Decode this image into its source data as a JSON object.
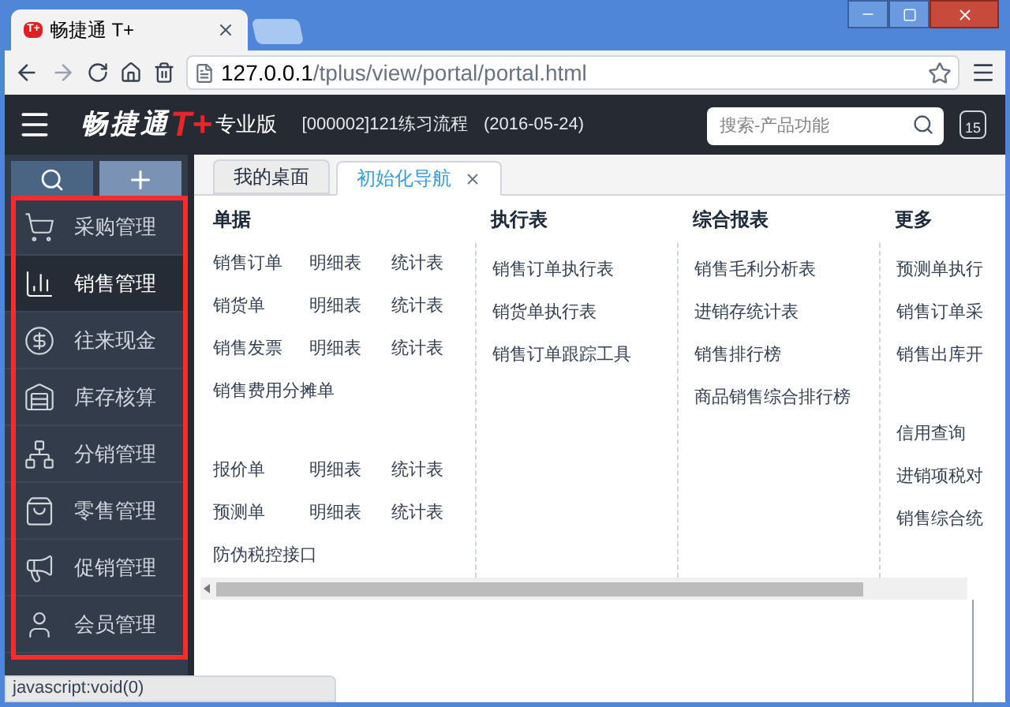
{
  "browser": {
    "tab": {
      "favicon_text": "T+",
      "title": "畅捷通 T+"
    },
    "url_host": "127.0.0.1",
    "url_path": "/tplus/view/portal/portal.html",
    "status_text": "javascript:void(0)"
  },
  "header": {
    "logo_text": "畅捷通",
    "logo_mark": "T+",
    "edition": "专业版",
    "company": "[000002]121练习流程",
    "date": "(2016-05-24)",
    "search": {
      "placeholder": "搜索-产品功能"
    },
    "calendar_day": "15"
  },
  "sidebar": {
    "items": [
      {
        "label": "采购管理",
        "selected": false
      },
      {
        "label": "销售管理",
        "selected": true
      },
      {
        "label": "往来现金",
        "selected": false
      },
      {
        "label": "库存核算",
        "selected": false
      },
      {
        "label": "分销管理",
        "selected": false
      },
      {
        "label": "零售管理",
        "selected": false
      },
      {
        "label": "促销管理",
        "selected": false
      },
      {
        "label": "会员管理",
        "selected": false
      }
    ]
  },
  "tabs": [
    {
      "label": "我的桌面",
      "selected": false,
      "closable": false
    },
    {
      "label": "初始化导航",
      "selected": true,
      "closable": true
    }
  ],
  "columns": [
    {
      "title": "单据",
      "groups": [
        [
          [
            "销售订单",
            "明细表",
            "统计表"
          ],
          [
            "销货单",
            "明细表",
            "统计表"
          ],
          [
            "销售发票",
            "明细表",
            "统计表"
          ],
          [
            "销售费用分摊单"
          ]
        ],
        [
          [
            "报价单",
            "明细表",
            "统计表"
          ],
          [
            "预测单",
            "明细表",
            "统计表"
          ],
          [
            "防伪税控接口"
          ]
        ]
      ]
    },
    {
      "title": "执行表",
      "groups": [
        [
          [
            "销售订单执行表"
          ],
          [
            "销货单执行表"
          ],
          [
            "销售订单跟踪工具"
          ]
        ]
      ]
    },
    {
      "title": "综合报表",
      "groups": [
        [
          [
            "销售毛利分析表"
          ],
          [
            "进销存统计表"
          ],
          [
            "销售排行榜"
          ],
          [
            "商品销售综合排行榜"
          ]
        ]
      ]
    },
    {
      "title": "更多",
      "groups": [
        [
          [
            "预测单执行"
          ],
          [
            "销售订单采"
          ],
          [
            "销售出库开"
          ]
        ],
        [
          [
            "信用查询"
          ],
          [
            "进销项税对"
          ],
          [
            "销售综合统"
          ]
        ]
      ]
    }
  ]
}
